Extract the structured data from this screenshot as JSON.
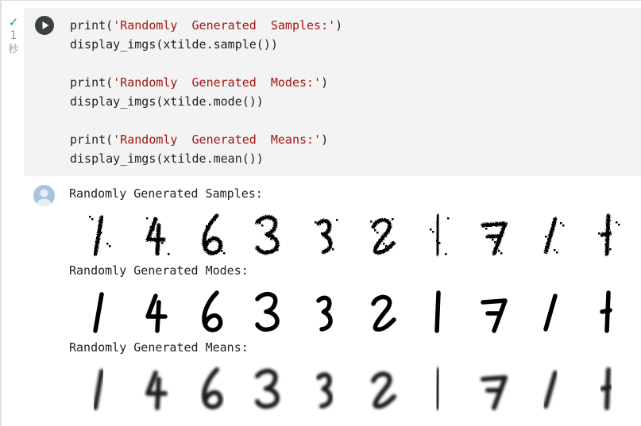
{
  "cell": {
    "status_icon": "check-icon",
    "exec_count": "1",
    "exec_unit": "秒",
    "run_icon": "play-icon",
    "code_lines": [
      {
        "fn": "print(",
        "str": "'Randomly  Generated  Samples:'",
        "end": ")"
      },
      {
        "fn": "display_imgs(xtilde.sample())",
        "str": "",
        "end": ""
      },
      {
        "fn": "",
        "str": "",
        "end": ""
      },
      {
        "fn": "print(",
        "str": "'Randomly  Generated  Modes:'",
        "end": ")"
      },
      {
        "fn": "display_imgs(xtilde.mode())",
        "str": "",
        "end": ""
      },
      {
        "fn": "",
        "str": "",
        "end": ""
      },
      {
        "fn": "print(",
        "str": "'Randomly  Generated  Means:'",
        "end": ")"
      },
      {
        "fn": "display_imgs(xtilde.mean())",
        "str": "",
        "end": ""
      }
    ]
  },
  "output": {
    "icon": "output-avatar-icon",
    "sections": [
      {
        "label": "Randomly Generated Samples:",
        "style": "samples"
      },
      {
        "label": "Randomly Generated Modes:",
        "style": "modes"
      },
      {
        "label": "Randomly Generated Means:",
        "style": "means"
      }
    ],
    "digits": [
      "1",
      "4",
      "6",
      "3",
      "3",
      "2",
      "1",
      "7",
      "1",
      "1"
    ]
  },
  "colors": {
    "check": "#0f9d58",
    "string": "#a31515",
    "cell_bg": "#f3f3f3",
    "avatar": "#a8c2e0"
  }
}
